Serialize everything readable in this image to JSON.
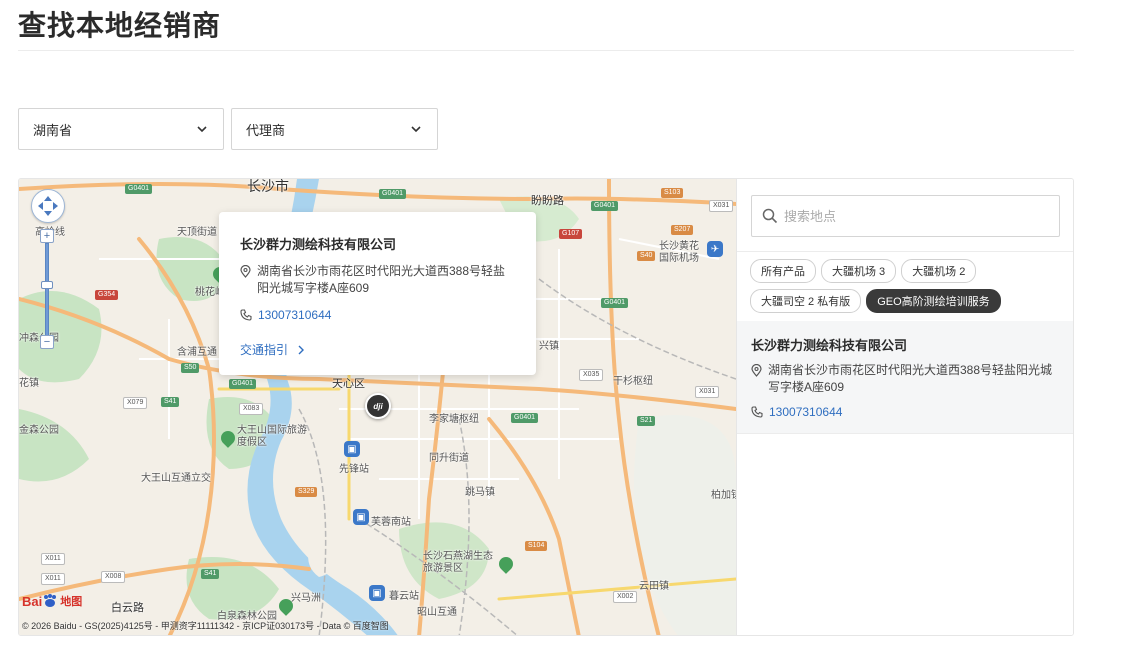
{
  "page": {
    "title": "查找本地经销商"
  },
  "filters": {
    "province": {
      "value": "湖南省"
    },
    "dealer_type": {
      "value": "代理商"
    }
  },
  "map": {
    "labels": {
      "changsha": "长沙市",
      "panlong": "盼盼路",
      "tianxing": "天顶街道",
      "taohua": "桃花岭",
      "chongsen": "冲森公园",
      "hanpu": "含浦互通",
      "huazhen": "花镇",
      "tianxin": "天心区",
      "lijia": "李家塘枢纽",
      "dawangshan": "大王山国际旅游度假区",
      "dawangshan2": "大王山互通立交",
      "xianfeng": "先锋站",
      "tongsheng": "同升街道",
      "tiaoma": "跳马镇",
      "furong": "芙蓉南站",
      "shiyan": "长沙石燕湖生态旅游景区",
      "baiyun": "白云路",
      "xingma": "兴马洲",
      "muyun": "暮云站",
      "baiquan": "白泉森林公园",
      "zhaoshan": "昭山互通",
      "yuntian": "云田镇",
      "airport": "长沙黄花国际机场",
      "gaosheng": "高岭线",
      "jinshan": "金森公园",
      "ganshan": "干杉枢纽",
      "xingzhen": "兴镇",
      "baichuan": "柏加镇"
    },
    "badges": {
      "g0401a": "G0401",
      "g0401b": "G0401",
      "g0401c": "G0401",
      "g0401d": "G0401",
      "g0401e": "G0401",
      "g0401f": "G0401",
      "g354": "G354",
      "s50": "S50",
      "s207": "S207",
      "s103": "S103",
      "s40": "S40",
      "g107": "G107",
      "x031a": "X031",
      "x031b": "X031",
      "x035": "X035",
      "x079": "X079",
      "x083": "X083",
      "s41": "S41",
      "s329": "S329",
      "s104": "S104",
      "s21": "S21",
      "x011a": "X011",
      "x011b": "X011",
      "x008": "X008",
      "x002": "X002",
      "s41b": "S41"
    },
    "marker_brand": "dji",
    "baidu_logo": "Bai",
    "baidu_logo2": "地图",
    "copyright": "© 2026 Baidu - GS(2025)4125号 - 甲测资字11111342 - 京ICP证030173号 - Data © 百度智图",
    "zoom": {
      "in": "+",
      "out": "−"
    }
  },
  "popup": {
    "name": "长沙群力测绘科技有限公司",
    "address": "湖南省长沙市雨花区时代阳光大道西388号轻盐阳光城写字楼A座609",
    "phone": "13007310644",
    "directions": "交通指引"
  },
  "search": {
    "placeholder": "搜索地点"
  },
  "tags": [
    {
      "label": "所有产品",
      "active": false
    },
    {
      "label": "大疆机场 3",
      "active": false
    },
    {
      "label": "大疆机场 2",
      "active": false
    },
    {
      "label": "大疆司空 2 私有版",
      "active": false
    },
    {
      "label": "GEO高阶测绘培训服务",
      "active": true
    }
  ],
  "results": [
    {
      "name": "长沙群力测绘科技有限公司",
      "address": "湖南省长沙市雨花区时代阳光大道西388号轻盐阳光城写字楼A座609",
      "phone": "13007310644"
    }
  ],
  "icons": {
    "chevron": "chevron-down-icon",
    "pin": "location-pin-icon",
    "phone": "phone-icon",
    "search": "search-icon",
    "arrow": "chevron-right-icon"
  },
  "colors": {
    "link": "#2f6ec0",
    "active_tag": "#3a3a3a",
    "result_bg": "#f5f6f7",
    "map_bg": "#f3efe7",
    "river": "#a9d3ee",
    "park": "#c8e4c3",
    "highway": "#f5b97a"
  }
}
